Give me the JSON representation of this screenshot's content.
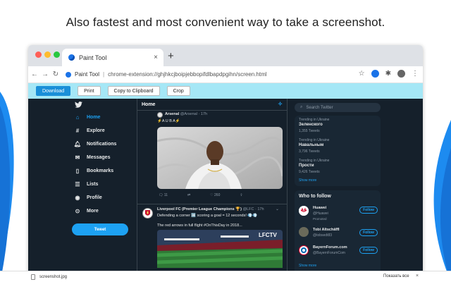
{
  "headline": "Also fastest and most convenient way to take a screenshot.",
  "colors": {
    "accent": "#1da1f2",
    "toolbar": "#a5e7f6",
    "twitter_bg": "#15202b",
    "download_btn": "#1a8fd8"
  },
  "browser": {
    "tab_title": "Paint Tool",
    "tab_close": "×",
    "new_tab": "+",
    "nav": {
      "back": "←",
      "forward": "→",
      "reload": "↻"
    },
    "site_name": "Paint Tool",
    "url": "chrome-extension://ghjhkcjboipjebbopifdlbapdpgihn/screen.html",
    "star": "☆",
    "menu": "⋮"
  },
  "toolbar": {
    "download": "Download",
    "print": "Print",
    "copy": "Copy to Clipboard",
    "crop": "Crop"
  },
  "twitter": {
    "nav": [
      {
        "icon": "bird-icon",
        "label": ""
      },
      {
        "icon": "home-icon",
        "label": "Home"
      },
      {
        "icon": "hashtag-icon",
        "label": "Explore"
      },
      {
        "icon": "bell-icon",
        "label": "Notifications"
      },
      {
        "icon": "mail-icon",
        "label": "Messages"
      },
      {
        "icon": "bookmark-icon",
        "label": "Bookmarks"
      },
      {
        "icon": "list-icon",
        "label": "Lists"
      },
      {
        "icon": "profile-icon",
        "label": "Profile"
      },
      {
        "icon": "more-icon",
        "label": "More"
      }
    ],
    "tweet_button": "Tweet",
    "feed_title": "Home",
    "tweet1": {
      "name": "Arsenal",
      "handle": "@Arsenal · 17h",
      "text": "⚡️A U B A⚡️",
      "actions": [
        "11",
        "",
        "",
        "260",
        ""
      ]
    },
    "tweet2": {
      "name": "Liverpool FC (Premier League Champions 🏆)",
      "handle": "@LFC · 17h",
      "line1": "Defending a corner ➡️ scoring a goal = 12 seconds! 💨💨",
      "line2": "The red arrows in full flight #OnThisDay in 2018...",
      "overlay": "LFCTV"
    },
    "search_placeholder": "Search Twitter",
    "trends": [
      {
        "meta": "Trending in Ukraine",
        "name": "Зеленского",
        "count": "1,355 Tweets"
      },
      {
        "meta": "Trending in Ukraine",
        "name": "Навальным",
        "count": "3,796 Tweets"
      },
      {
        "meta": "Trending in Ukraine",
        "name": "Прости",
        "count": "9,426 Tweets"
      }
    ],
    "show_more": "Show more",
    "who_to_follow": "Who to follow",
    "follow_suggestions": [
      {
        "name": "Huawei",
        "handle": "@Huawei",
        "extra": "Promoted",
        "follow": "Follow"
      },
      {
        "name": "Tobi Altschäffl",
        "handle": "@tobsedt83",
        "extra": "",
        "follow": "Follow"
      },
      {
        "name": "BayernForum.com",
        "handle": "@BayernForumCom",
        "extra": "",
        "follow": "Follow"
      }
    ]
  },
  "downloads": {
    "file": "screenshot.jpg",
    "show_all": "Показать все",
    "close": "×"
  }
}
